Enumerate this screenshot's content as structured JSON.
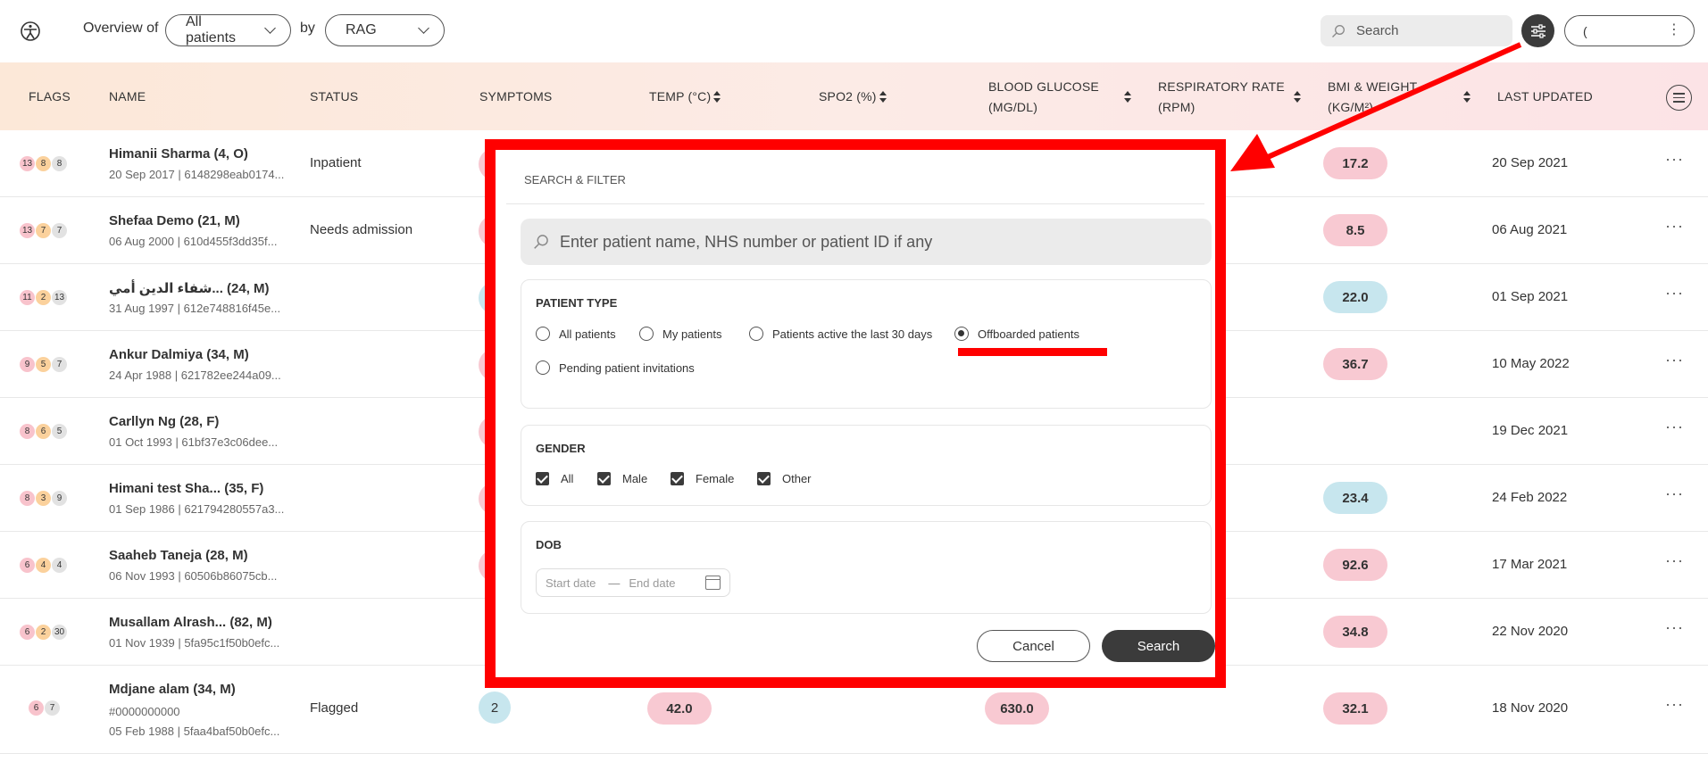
{
  "topbar": {
    "overview_label": "Overview of",
    "patients_select": "All patients",
    "by_label": "by",
    "group_select": "RAG",
    "search_placeholder": "Search",
    "user_text": "(",
    "user_menu": "⋮"
  },
  "table": {
    "headers": {
      "flags": "FLAGS",
      "name": "NAME",
      "status": "STATUS",
      "symptoms": "SYMPTOMS",
      "temp": "TEMP (°C)",
      "spo2": "SPO2 (%)",
      "glucose_1": "BLOOD GLUCOSE",
      "glucose_2": "(MG/DL)",
      "resp_1": "RESPIRATORY RATE",
      "resp_2": "(RPM)",
      "bmi_1": "BMI & WEIGHT",
      "bmi_2": "(KG/M²)",
      "last_updated": "LAST UPDATED"
    },
    "rows": [
      {
        "flags": [
          "13",
          "8",
          "8"
        ],
        "name": "Himanii Sharma (4, O)",
        "sub": "20 Sep 2017 | 6148298eab0174...",
        "status": "Inpatient",
        "bmi": "17.2",
        "last_updated": "20 Sep 2021"
      },
      {
        "flags": [
          "13",
          "7",
          "7"
        ],
        "name": "Shefaa Demo (21, M)",
        "sub": "06 Aug 2000 | 610d455f3dd35f...",
        "status": "Needs admission",
        "bmi": "8.5",
        "last_updated": "06 Aug 2021"
      },
      {
        "flags": [
          "11",
          "2",
          "13"
        ],
        "name": "شفاء الدين أمي... (24, M)",
        "sub": "31 Aug 1997 | 612e748816f45e...",
        "status": "",
        "bmi": "22.0",
        "last_updated": "01 Sep 2021"
      },
      {
        "flags": [
          "9",
          "5",
          "7"
        ],
        "name": "Ankur Dalmiya (34, M)",
        "sub": "24 Apr 1988 | 621782ee244a09...",
        "status": "",
        "bmi": "36.7",
        "last_updated": "10 May 2022"
      },
      {
        "flags": [
          "8",
          "6",
          "5"
        ],
        "name": "Carllyn Ng (28, F)",
        "sub": "01 Oct 1993 | 61bf37e3c06dee...",
        "status": "",
        "bmi": "",
        "last_updated": "19 Dec 2021"
      },
      {
        "flags": [
          "8",
          "3",
          "9"
        ],
        "name": "Himani test Sha... (35, F)",
        "sub": "01 Sep 1986 | 621794280557a3...",
        "status": "",
        "bmi": "23.4",
        "last_updated": "24 Feb 2022"
      },
      {
        "flags": [
          "6",
          "4",
          "4"
        ],
        "name": "Saaheb Taneja (28, M)",
        "sub": "06 Nov 1993 | 60506b86075cb...",
        "status": "",
        "bmi": "92.6",
        "last_updated": "17 Mar 2021"
      },
      {
        "flags": [
          "6",
          "2",
          "30"
        ],
        "name": "Musallam Alrash... (82, M)",
        "sub": "01 Nov 1939 | 5fa95c1f50b0efc...",
        "status": "",
        "bmi": "34.8",
        "last_updated": "22 Nov 2020"
      },
      {
        "flags": [
          "6",
          "7"
        ],
        "name": "Mdjane alam (34, M)",
        "sub_1": "#0000000000",
        "sub": "05 Feb 1988 | 5faa4baf50b0efc...",
        "status": "Flagged",
        "symptoms": "2",
        "temp": "42.0",
        "glucose": "630.0",
        "bmi": "32.1",
        "last_updated": "18 Nov 2020"
      }
    ],
    "row_menu": "···"
  },
  "modal": {
    "title": "SEARCH & FILTER",
    "search_placeholder": "Enter patient name, NHS number or patient ID if any",
    "patient_type": {
      "title": "PATIENT TYPE",
      "options": [
        "All patients",
        "My patients",
        "Patients active the last 30 days",
        "Offboarded patients",
        "Pending patient invitations"
      ],
      "selected": "Offboarded patients"
    },
    "gender": {
      "title": "GENDER",
      "options": [
        "All",
        "Male",
        "Female",
        "Other"
      ]
    },
    "dob": {
      "title": "DOB",
      "start_placeholder": "Start date",
      "end_placeholder": "End date"
    },
    "cancel_label": "Cancel",
    "search_label": "Search"
  },
  "colors": {
    "annotation": "#ff0000",
    "header_bg": "#fce8d8",
    "dark_button": "#3b3b3b",
    "red_pill": "#f8c9d2",
    "blue_pill": "#c7e6ee"
  }
}
